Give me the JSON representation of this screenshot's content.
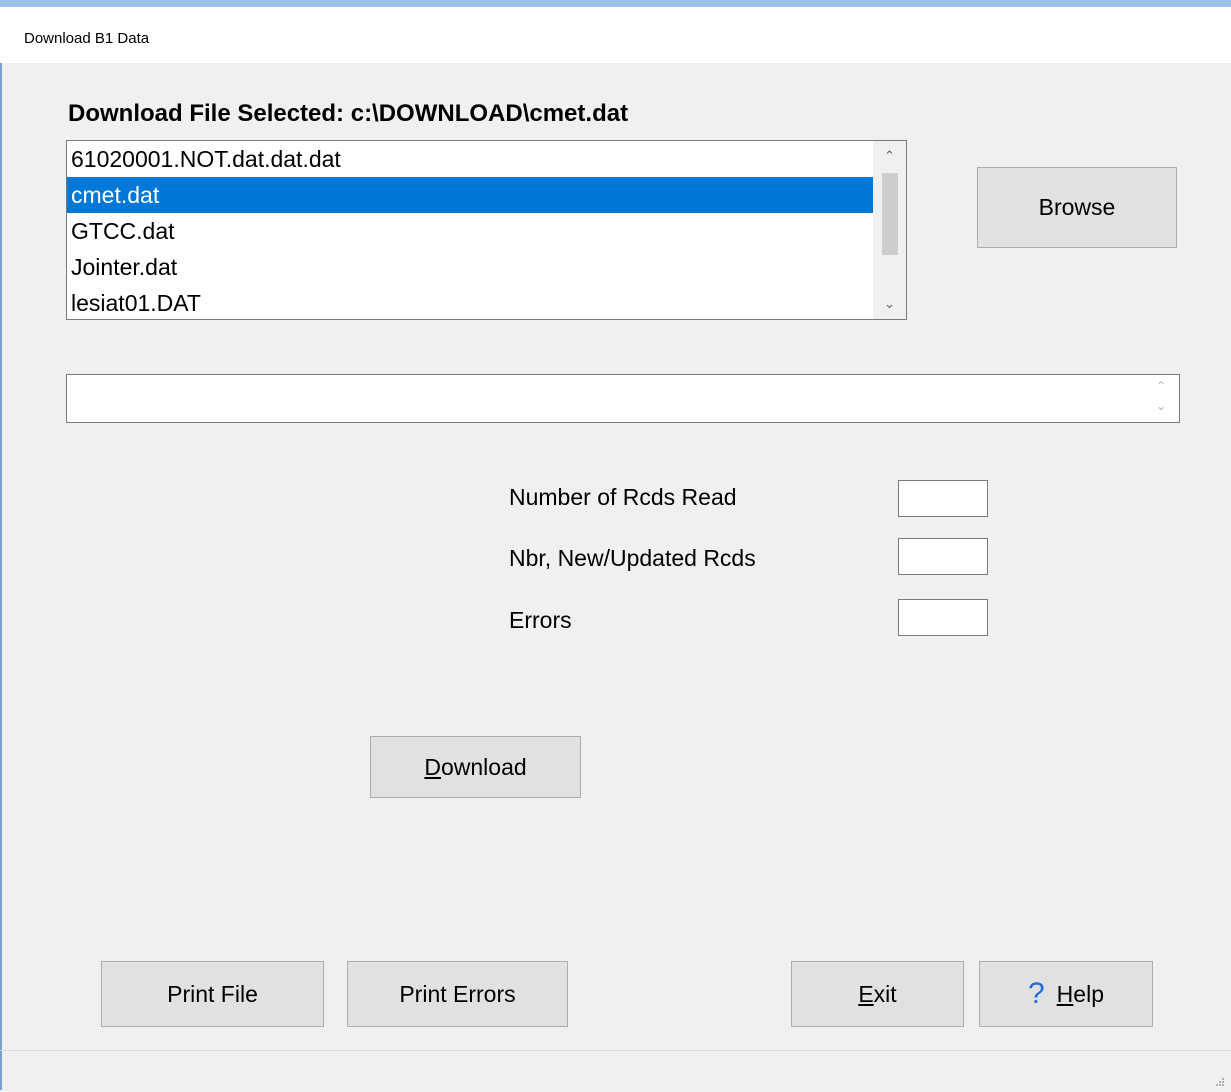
{
  "window": {
    "title": "Download B1 Data"
  },
  "file_selected_label": "Download File Selected: c:\\DOWNLOAD\\cmet.dat",
  "file_list": {
    "items": [
      "61020001.NOT.dat.dat.dat",
      "cmet.dat",
      "GTCC.dat",
      "Jointer.dat",
      "lesiat01.DAT"
    ],
    "selected": "cmet.dat"
  },
  "buttons": {
    "browse": "Browse",
    "download_rest": "ownload",
    "download_mnemonic": "D",
    "print_file": "Print File",
    "print_errors": "Print Errors",
    "exit_mnemonic": "E",
    "exit_rest": "xit",
    "help_mnemonic": "H",
    "help_rest": "elp"
  },
  "status_text": "",
  "stats": {
    "records_read_label": "Number of Rcds Read",
    "records_read_value": "",
    "new_updated_label": "Nbr, New/Updated Rcds",
    "new_updated_value": "",
    "errors_label": "Errors",
    "errors_value": ""
  },
  "colors": {
    "selection": "#0078d7",
    "title_accent": "#9dc1e8",
    "help_icon": "#1e6fd9"
  },
  "icons": {
    "help": "question-mark-icon",
    "scroll_up": "chevron-up-icon",
    "scroll_down": "chevron-down-icon"
  }
}
